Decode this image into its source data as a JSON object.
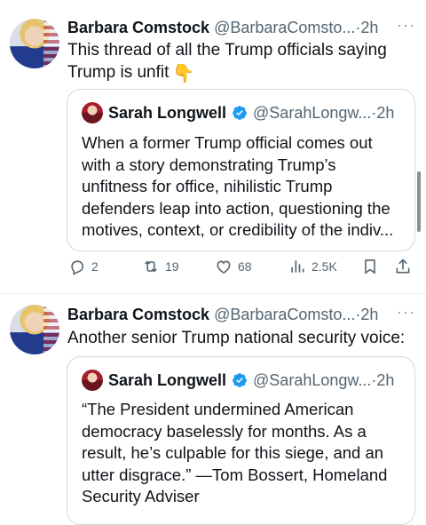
{
  "tweets": [
    {
      "author_name": "Barbara Comstock",
      "handle_time": "@BarbaraComsto...·2h",
      "text": "This thread of all the Trump officials saying Trump is unfit",
      "emoji": "👇",
      "quote": {
        "author_name": "Sarah Longwell",
        "handle_time": "@SarahLongw...·2h",
        "text": "When a former Trump official comes out with a story demonstrating Trump’s unfitness for office, nihilistic Trump defenders leap into action, questioning the motives, context, or credibility of the indiv..."
      },
      "stats": {
        "replies": "2",
        "retweets": "19",
        "likes": "68",
        "views": "2.5K"
      }
    },
    {
      "author_name": "Barbara Comstock",
      "handle_time": "@BarbaraComsto...·2h",
      "text": "Another senior Trump national security voice:",
      "quote": {
        "author_name": "Sarah Longwell",
        "handle_time": "@SarahLongw...·2h",
        "text": "“The President undermined American democracy baselessly for months. As a result, he’s culpable for this siege, and an utter disgrace.” —Tom Bossert, Homeland Security Adviser"
      }
    }
  ],
  "more_label": "···",
  "colors": {
    "verified": "#1d9bf0",
    "muted": "#536471",
    "border": "#cfd9de"
  },
  "icons": [
    "reply-icon",
    "retweet-icon",
    "like-icon",
    "views-icon",
    "bookmark-icon",
    "share-icon",
    "verified-badge-icon"
  ]
}
